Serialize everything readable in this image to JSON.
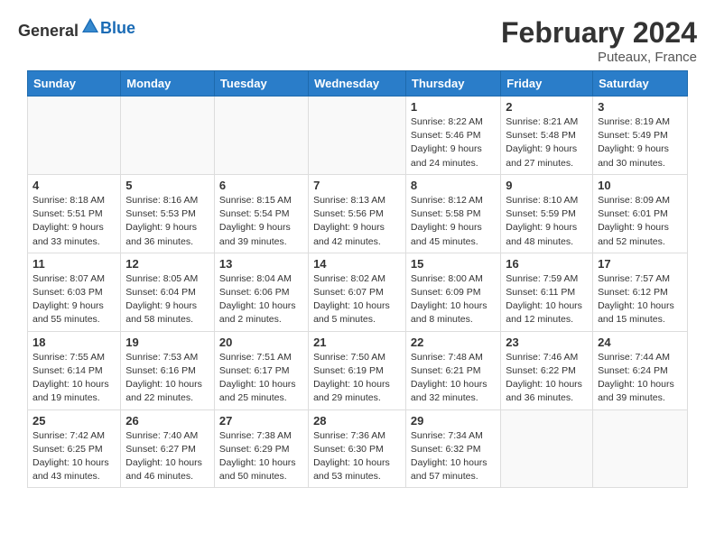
{
  "header": {
    "logo_general": "General",
    "logo_blue": "Blue",
    "month_title": "February 2024",
    "location": "Puteaux, France"
  },
  "weekdays": [
    "Sunday",
    "Monday",
    "Tuesday",
    "Wednesday",
    "Thursday",
    "Friday",
    "Saturday"
  ],
  "weeks": [
    [
      {
        "day": "",
        "info": ""
      },
      {
        "day": "",
        "info": ""
      },
      {
        "day": "",
        "info": ""
      },
      {
        "day": "",
        "info": ""
      },
      {
        "day": "1",
        "info": "Sunrise: 8:22 AM\nSunset: 5:46 PM\nDaylight: 9 hours\nand 24 minutes."
      },
      {
        "day": "2",
        "info": "Sunrise: 8:21 AM\nSunset: 5:48 PM\nDaylight: 9 hours\nand 27 minutes."
      },
      {
        "day": "3",
        "info": "Sunrise: 8:19 AM\nSunset: 5:49 PM\nDaylight: 9 hours\nand 30 minutes."
      }
    ],
    [
      {
        "day": "4",
        "info": "Sunrise: 8:18 AM\nSunset: 5:51 PM\nDaylight: 9 hours\nand 33 minutes."
      },
      {
        "day": "5",
        "info": "Sunrise: 8:16 AM\nSunset: 5:53 PM\nDaylight: 9 hours\nand 36 minutes."
      },
      {
        "day": "6",
        "info": "Sunrise: 8:15 AM\nSunset: 5:54 PM\nDaylight: 9 hours\nand 39 minutes."
      },
      {
        "day": "7",
        "info": "Sunrise: 8:13 AM\nSunset: 5:56 PM\nDaylight: 9 hours\nand 42 minutes."
      },
      {
        "day": "8",
        "info": "Sunrise: 8:12 AM\nSunset: 5:58 PM\nDaylight: 9 hours\nand 45 minutes."
      },
      {
        "day": "9",
        "info": "Sunrise: 8:10 AM\nSunset: 5:59 PM\nDaylight: 9 hours\nand 48 minutes."
      },
      {
        "day": "10",
        "info": "Sunrise: 8:09 AM\nSunset: 6:01 PM\nDaylight: 9 hours\nand 52 minutes."
      }
    ],
    [
      {
        "day": "11",
        "info": "Sunrise: 8:07 AM\nSunset: 6:03 PM\nDaylight: 9 hours\nand 55 minutes."
      },
      {
        "day": "12",
        "info": "Sunrise: 8:05 AM\nSunset: 6:04 PM\nDaylight: 9 hours\nand 58 minutes."
      },
      {
        "day": "13",
        "info": "Sunrise: 8:04 AM\nSunset: 6:06 PM\nDaylight: 10 hours\nand 2 minutes."
      },
      {
        "day": "14",
        "info": "Sunrise: 8:02 AM\nSunset: 6:07 PM\nDaylight: 10 hours\nand 5 minutes."
      },
      {
        "day": "15",
        "info": "Sunrise: 8:00 AM\nSunset: 6:09 PM\nDaylight: 10 hours\nand 8 minutes."
      },
      {
        "day": "16",
        "info": "Sunrise: 7:59 AM\nSunset: 6:11 PM\nDaylight: 10 hours\nand 12 minutes."
      },
      {
        "day": "17",
        "info": "Sunrise: 7:57 AM\nSunset: 6:12 PM\nDaylight: 10 hours\nand 15 minutes."
      }
    ],
    [
      {
        "day": "18",
        "info": "Sunrise: 7:55 AM\nSunset: 6:14 PM\nDaylight: 10 hours\nand 19 minutes."
      },
      {
        "day": "19",
        "info": "Sunrise: 7:53 AM\nSunset: 6:16 PM\nDaylight: 10 hours\nand 22 minutes."
      },
      {
        "day": "20",
        "info": "Sunrise: 7:51 AM\nSunset: 6:17 PM\nDaylight: 10 hours\nand 25 minutes."
      },
      {
        "day": "21",
        "info": "Sunrise: 7:50 AM\nSunset: 6:19 PM\nDaylight: 10 hours\nand 29 minutes."
      },
      {
        "day": "22",
        "info": "Sunrise: 7:48 AM\nSunset: 6:21 PM\nDaylight: 10 hours\nand 32 minutes."
      },
      {
        "day": "23",
        "info": "Sunrise: 7:46 AM\nSunset: 6:22 PM\nDaylight: 10 hours\nand 36 minutes."
      },
      {
        "day": "24",
        "info": "Sunrise: 7:44 AM\nSunset: 6:24 PM\nDaylight: 10 hours\nand 39 minutes."
      }
    ],
    [
      {
        "day": "25",
        "info": "Sunrise: 7:42 AM\nSunset: 6:25 PM\nDaylight: 10 hours\nand 43 minutes."
      },
      {
        "day": "26",
        "info": "Sunrise: 7:40 AM\nSunset: 6:27 PM\nDaylight: 10 hours\nand 46 minutes."
      },
      {
        "day": "27",
        "info": "Sunrise: 7:38 AM\nSunset: 6:29 PM\nDaylight: 10 hours\nand 50 minutes."
      },
      {
        "day": "28",
        "info": "Sunrise: 7:36 AM\nSunset: 6:30 PM\nDaylight: 10 hours\nand 53 minutes."
      },
      {
        "day": "29",
        "info": "Sunrise: 7:34 AM\nSunset: 6:32 PM\nDaylight: 10 hours\nand 57 minutes."
      },
      {
        "day": "",
        "info": ""
      },
      {
        "day": "",
        "info": ""
      }
    ]
  ]
}
